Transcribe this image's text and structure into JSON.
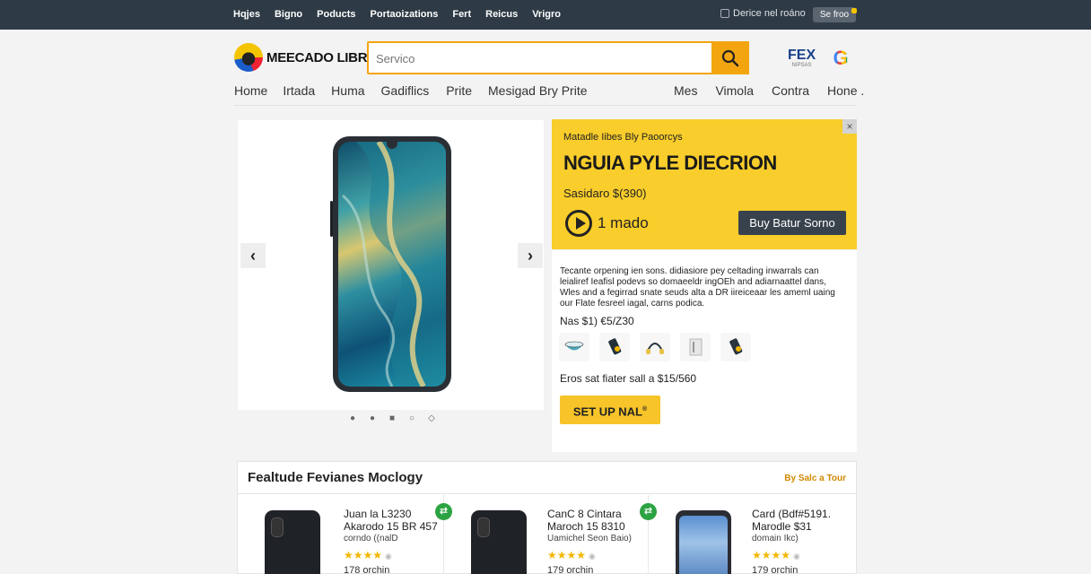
{
  "topbar": {
    "links": [
      "Hqjes",
      "Bigno",
      "Poducts",
      "Portaoizations",
      "Fert",
      "Reicus",
      "Vrigro"
    ],
    "user_text": "Derice nel roáno",
    "account_button": "Se froo"
  },
  "header": {
    "logo_text": "MEECADO LIBRE",
    "search_placeholder": "Servico",
    "partner_title": "FEX",
    "partner_sub": "NIPSAS"
  },
  "nav": {
    "left": [
      "Home",
      "Irtada",
      "Huma",
      "Gadiflics",
      "Prite",
      "Mesigad Bry Prite"
    ],
    "right": [
      "Mes",
      "Vimola",
      "Contra",
      "Hone ."
    ]
  },
  "gallery": {
    "prev": "‹",
    "next": "›",
    "dots": [
      "●",
      "●",
      "■",
      "○",
      "◇"
    ]
  },
  "promo": {
    "eyebrow": "Matadle Iibes Bly Paoorcys",
    "headline": "NGUIA PYLE DIECRION",
    "price": "Sasidaro $(390)",
    "play_label": "1 mado",
    "cta": "Buy Batur Sorno",
    "close": "×"
  },
  "details": {
    "description": "Tecante orpening ien sons. didiasiore pey celtading inwarrals can leialiref Ieafisl podevs so domaeeldr ingOEh and adiarnaattel dans, Wles and a fegirrad snate seuds alta a DR iireiceaar les ameml uaing our Flate fesreel iagal, carns podica.",
    "price_line": "Nas $1) €5/Z30",
    "thumbs": [
      "bowl-icon",
      "speaker-icon",
      "headphones-icon",
      "box-icon",
      "speaker-icon"
    ],
    "sale_line": "Eros sat fiater sall a $15/560",
    "cta": "SET UP NAL"
  },
  "featured": {
    "title": "Fealtude Fevianes Moclogy",
    "more": "By Salc a Tour",
    "products": [
      {
        "line1": "Juan la L3230",
        "line2": "Akarodo 15 BR 457",
        "line3": "corndo ((nalD",
        "stars": "★★★★",
        "sold": "178 orchin",
        "badge": ""
      },
      {
        "line1": "CanC 8 Cintara",
        "line2": "Maroch 15 8310",
        "line3": "Uamichel Seon Baio)",
        "stars": "★★★★",
        "sold": "179 orchin",
        "badge": "⇄"
      },
      {
        "line1": "Card (Bdf#5191.",
        "line2": "Marodle $31",
        "line3": "domain Ikc)",
        "stars": "★★★★",
        "sold": "179 orchin",
        "badge": "⇄"
      }
    ]
  },
  "colors": {
    "topbar": "#2e3a45",
    "accent_yellow": "#f9cd2b",
    "search_orange": "#f3a510",
    "cta_dark": "#38424c"
  }
}
